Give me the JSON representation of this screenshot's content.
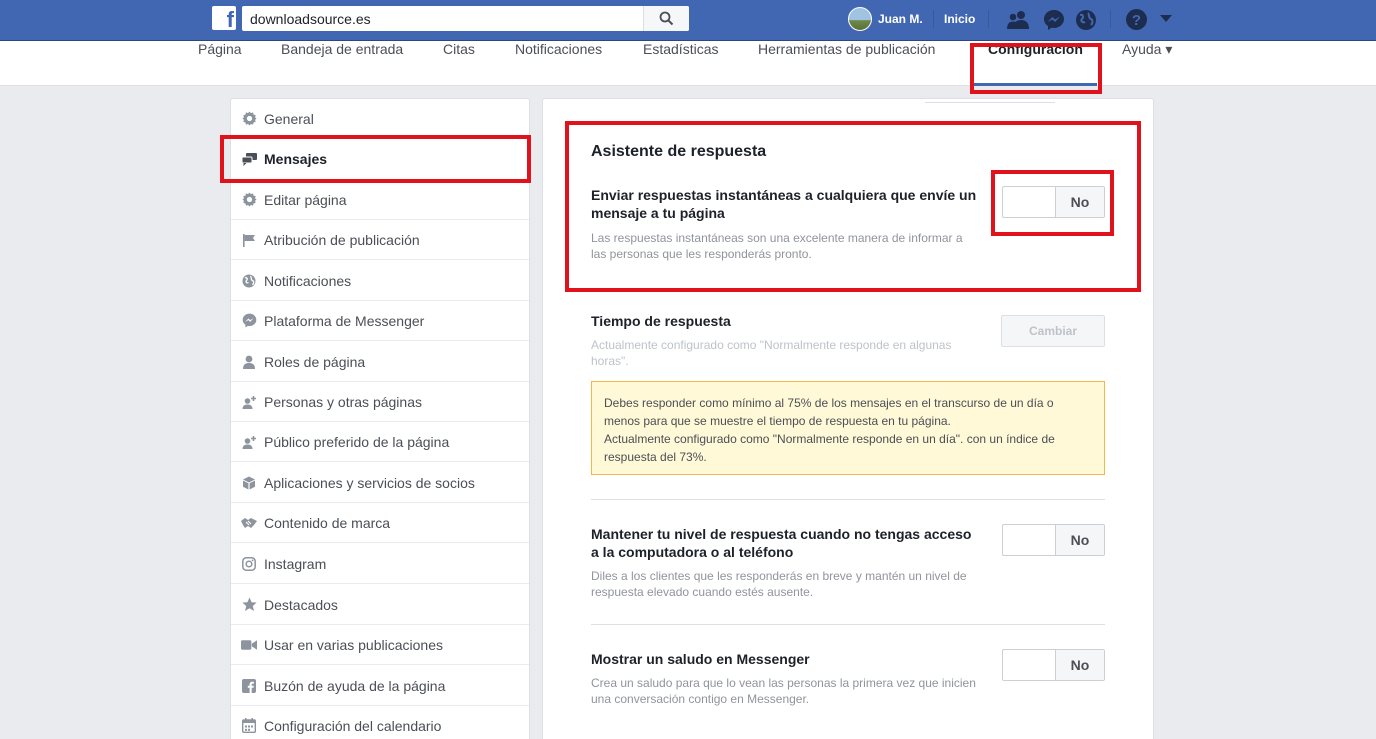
{
  "topbar": {
    "logo": "f",
    "search_value": "downloadsource.es",
    "user_name": "Juan M.",
    "home_label": "Inicio",
    "icons": [
      "search-icon",
      "friends-icon",
      "messenger-icon",
      "globe-icon",
      "help-icon",
      "caret-down-icon"
    ]
  },
  "pagenav": {
    "tabs": [
      {
        "label": "Página"
      },
      {
        "label": "Bandeja de entrada"
      },
      {
        "label": "Citas"
      },
      {
        "label": "Notificaciones"
      },
      {
        "label": "Estadísticas"
      },
      {
        "label": "Herramientas de publicación"
      },
      {
        "label": "Configuración"
      },
      {
        "label": "Ayuda ▾"
      }
    ],
    "active_tab": "Configuración"
  },
  "sidebar": {
    "items": [
      {
        "label": "General",
        "icon": "gear-icon"
      },
      {
        "label": "Mensajes",
        "icon": "messages-icon"
      },
      {
        "label": "Editar página",
        "icon": "gear-icon"
      },
      {
        "label": "Atribución de publicación",
        "icon": "flag-icon"
      },
      {
        "label": "Notificaciones",
        "icon": "globe-icon"
      },
      {
        "label": "Plataforma de Messenger",
        "icon": "messenger-icon"
      },
      {
        "label": "Roles de página",
        "icon": "person-icon"
      },
      {
        "label": "Personas y otras páginas",
        "icon": "person-plus-icon"
      },
      {
        "label": "Público preferido de la página",
        "icon": "person-plus-icon"
      },
      {
        "label": "Aplicaciones y servicios de socios",
        "icon": "cube-icon"
      },
      {
        "label": "Contenido de marca",
        "icon": "handshake-icon"
      },
      {
        "label": "Instagram",
        "icon": "instagram-icon"
      },
      {
        "label": "Destacados",
        "icon": "star-icon"
      },
      {
        "label": "Usar en varias publicaciones",
        "icon": "video-icon"
      },
      {
        "label": "Buzón de ayuda de la página",
        "icon": "facebook-icon"
      },
      {
        "label": "Configuración del calendario",
        "icon": "calendar-icon"
      }
    ],
    "active_item": "Mensajes"
  },
  "main": {
    "assistant": {
      "title": "Asistente de respuesta",
      "setting_title": "Enviar respuestas instantáneas a cualquiera que envíe un mensaje a tu página",
      "setting_desc": "Las respuestas instantáneas son una excelente manera de informar a las personas que les responderás pronto.",
      "toggle_label": "No"
    },
    "response_time": {
      "title": "Tiempo de respuesta",
      "desc": "Actualmente configurado como \"Normalmente responde en algunas horas\".",
      "button_label": "Cambiar",
      "notice_line1": "Debes responder como mínimo al 75% de los mensajes en el transcurso de un día o menos para que se muestre el tiempo de respuesta en tu página.",
      "notice_line2": "Actualmente configurado como \"Normalmente responde en un día\". con un índice de respuesta del 73%."
    },
    "away": {
      "title": "Mantener tu nivel de respuesta cuando no tengas acceso a la computadora o al teléfono",
      "desc": "Diles a los clientes que les responderás en breve y mantén un nivel de respuesta elevado cuando estés ausente.",
      "toggle_label": "No"
    },
    "greeting": {
      "title": "Mostrar un saludo en Messenger",
      "desc": "Crea un saludo para que lo vean las personas la primera vez que inicien una conversación contigo en Messenger.",
      "toggle_label": "No"
    }
  },
  "colors": {
    "topbar": "#4267b2",
    "highlight": "#e0121c",
    "notice_bg": "#fff9d7",
    "notice_border": "#f0b849"
  }
}
